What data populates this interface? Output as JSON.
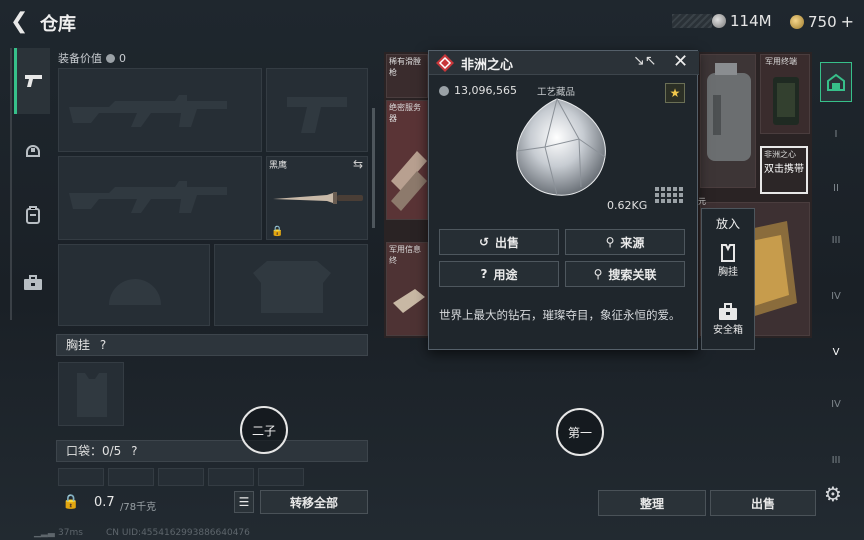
{
  "header": {
    "title": "仓库",
    "currency1": "114M",
    "currency2": "750",
    "plus": "+"
  },
  "left": {
    "equip_value_label": "装备价值",
    "equip_value": "0",
    "knife_label": "黑鹰",
    "chest_section": "胸挂",
    "pocket_section": "口袋：0/5",
    "help": "?",
    "circle_label": "二子",
    "weight_current": "0.7",
    "weight_max": "/78千克",
    "transfer_all": "转移全部"
  },
  "grid": {
    "labels": [
      "稀有滑膛枪",
      "绝密服务器",
      "军用信息终",
      "军用终端",
      "非洲之心"
    ],
    "highlight_text": "双击携带",
    "currency_tag": "元"
  },
  "popup": {
    "title": "非洲之心",
    "price": "13,096,565",
    "category": "工艺藏品",
    "weight": "0.62KG",
    "btn_sell": "出售",
    "btn_source": "来源",
    "btn_use": "用途",
    "btn_search": "搜索关联",
    "description": "世界上最大的钻石，璀璨夺目，象征永恒的爱。"
  },
  "side_actions": {
    "put_in": "放入",
    "chest": "胸挂",
    "safebox": "安全箱"
  },
  "right": {
    "circle_label": "第一",
    "organize": "整理",
    "sell": "出售",
    "sidebar": [
      "I",
      "II",
      "III",
      "IV",
      "V",
      "IV",
      "III",
      "V"
    ]
  },
  "footer": {
    "ping": "37ms",
    "uid": "CN UID:4554162993886640476"
  },
  "colors": {
    "accent": "#37c08a",
    "diamond_red": "#c8373a"
  }
}
